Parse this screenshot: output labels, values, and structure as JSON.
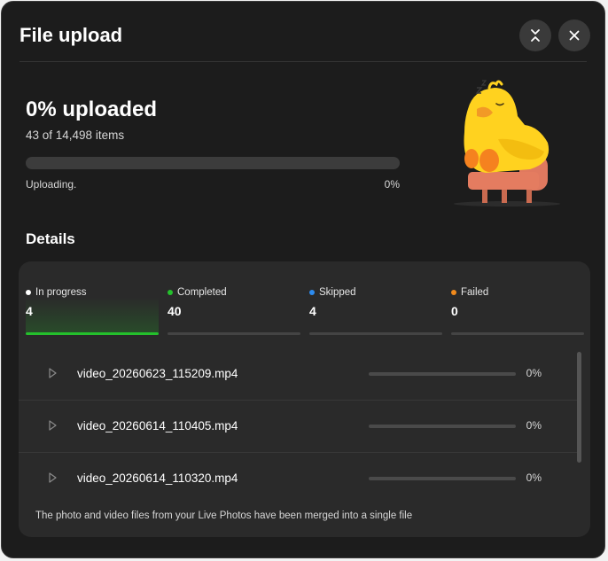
{
  "header": {
    "title": "File upload"
  },
  "summary": {
    "percent_text": "0% uploaded",
    "items_text": "43 of 14,498 items",
    "progress": 0,
    "status": "Uploading.",
    "status_percent": "0%"
  },
  "details_heading": "Details",
  "tabs": [
    {
      "label": "In progress",
      "count": "4",
      "dot_color": "#ffffff",
      "active": true
    },
    {
      "label": "Completed",
      "count": "40",
      "dot_color": "#24c02c",
      "active": false
    },
    {
      "label": "Skipped",
      "count": "4",
      "dot_color": "#2d8cf0",
      "active": false
    },
    {
      "label": "Failed",
      "count": "0",
      "dot_color": "#f08a1c",
      "active": false
    }
  ],
  "files": [
    {
      "name": "video_20260623_115209.mp4",
      "percent": "0%",
      "progress": 0
    },
    {
      "name": "video_20260614_110405.mp4",
      "percent": "0%",
      "progress": 0
    },
    {
      "name": "video_20260614_110320.mp4",
      "percent": "0%",
      "progress": 0
    }
  ],
  "footer_note": "The photo and video files from your Live Photos have been merged into a single file",
  "colors": {
    "background": "#1c1c1c",
    "panel": "#2a2a2a",
    "accent": "#24c02c"
  },
  "icons": {
    "collapse": "collapse-icon",
    "close": "close-icon",
    "play": "play-icon",
    "mascot": "sleeping-duck-on-sofa"
  }
}
